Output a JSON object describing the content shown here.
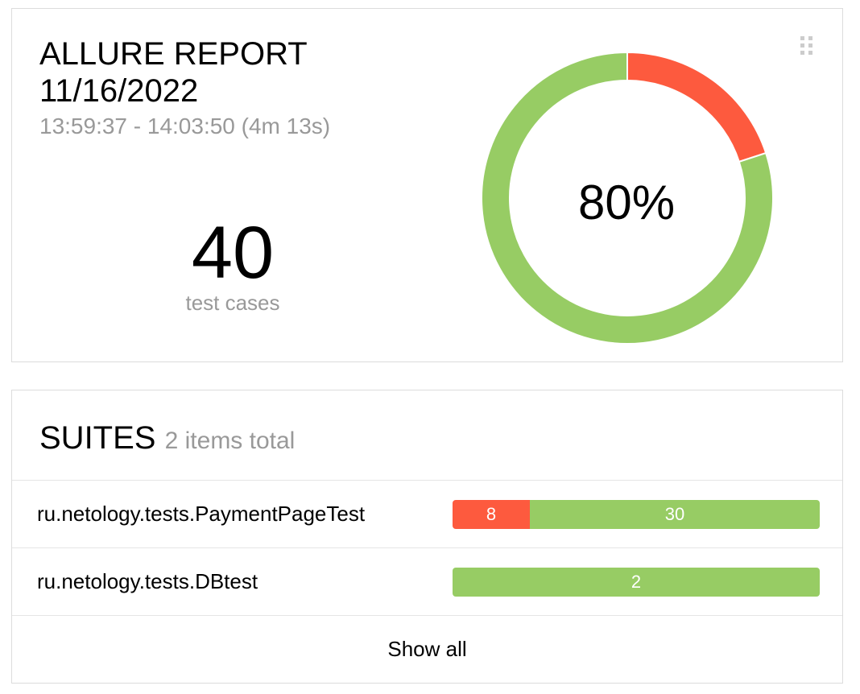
{
  "summary": {
    "title": "ALLURE REPORT\n11/16/2022",
    "time_range": "13:59:37 - 14:03:50 (4m 13s)",
    "total_count": "40",
    "total_label": "test cases",
    "success_rate_label": "80%",
    "status_counts": {
      "failed": 8,
      "passed": 32
    },
    "colors": {
      "failed": "#fd5a3e",
      "passed": "#97cc64"
    },
    "drag_icon": "drag-handle-icon"
  },
  "suites": {
    "title": "SUITES",
    "subtitle": "2 items total",
    "items": [
      {
        "name": "ru.netology.tests.PaymentPageTest",
        "segments": [
          {
            "status": "failed",
            "label": "8",
            "count": 8
          },
          {
            "status": "passed",
            "label": "30",
            "count": 30
          }
        ]
      },
      {
        "name": "ru.netology.tests.DBtest",
        "segments": [
          {
            "status": "passed",
            "label": "2",
            "count": 2
          }
        ]
      }
    ],
    "show_all_label": "Show all"
  }
}
